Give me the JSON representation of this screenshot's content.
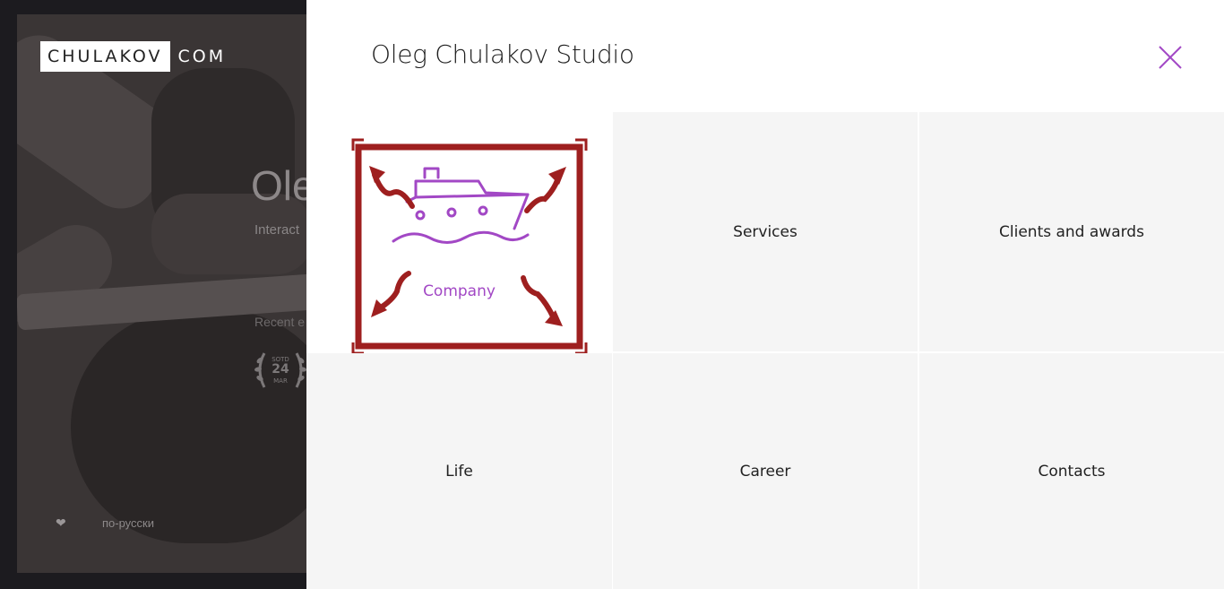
{
  "background": {
    "logo_box": "CHULAKOV",
    "logo_suffix": "COM",
    "title_partial": "Ole",
    "subtitle_partial": "Interact",
    "recent_partial": "Recent e",
    "badge": {
      "top": "SOTD",
      "day": "24",
      "month": "MAR"
    },
    "language_link": "по-русски",
    "heart_icon": "heart-icon"
  },
  "menu": {
    "title": "Oleg Chulakov Studio",
    "close_icon": "close-icon",
    "accent_color": "#a248c5",
    "items": [
      {
        "label": "Company",
        "active": true,
        "icon": "ship-icon"
      },
      {
        "label": "Services"
      },
      {
        "label": "Clients and awards"
      },
      {
        "label": "Life"
      },
      {
        "label": "Career"
      },
      {
        "label": "Contacts"
      }
    ]
  },
  "annotation": {
    "frame_color": "#9e1f1f",
    "icon": "expand-arrows-icon"
  }
}
